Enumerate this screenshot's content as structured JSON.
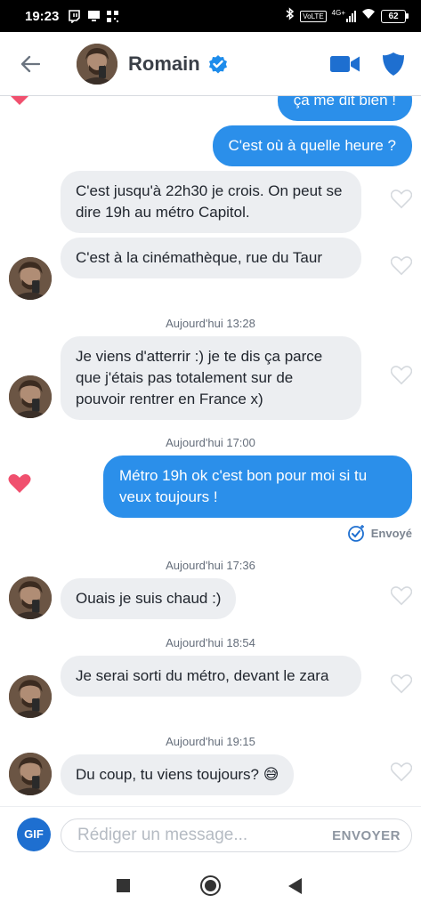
{
  "status_bar": {
    "time": "19:23",
    "network": "4G+",
    "lte": "VoLTE",
    "battery": "62"
  },
  "header": {
    "contact_name": "Romain"
  },
  "messages": {
    "m0": "ça me dit bien !",
    "m1": "C'est où à quelle heure ?",
    "m2": "C'est jusqu'à 22h30 je crois. On peut se dire 19h au métro Capitol.",
    "m3": "C'est à la cinémathèque, rue du Taur",
    "t1": "Aujourd'hui 13:28",
    "m4": "Je viens d'atterrir :) je te dis ça parce que j'étais pas totalement sur de pouvoir rentrer en France x)",
    "t2": "Aujourd'hui 17:00",
    "m5": "Métro 19h ok c'est bon pour moi si tu veux toujours !",
    "sent_status": "Envoyé",
    "t3": "Aujourd'hui 17:36",
    "m6": "Ouais je suis chaud :)",
    "t4": "Aujourd'hui 18:54",
    "m7": "Je serai sorti du métro, devant le zara",
    "t5": "Aujourd'hui 19:15",
    "m8": "Du coup, tu viens toujours? 😅"
  },
  "composer": {
    "gif_label": "GIF",
    "placeholder": "Rédiger un message...",
    "send_label": "ENVOYER"
  },
  "colors": {
    "accent_blue": "#2b8fea",
    "incoming_bubble": "#eceef1",
    "like_red": "#f0506e"
  }
}
